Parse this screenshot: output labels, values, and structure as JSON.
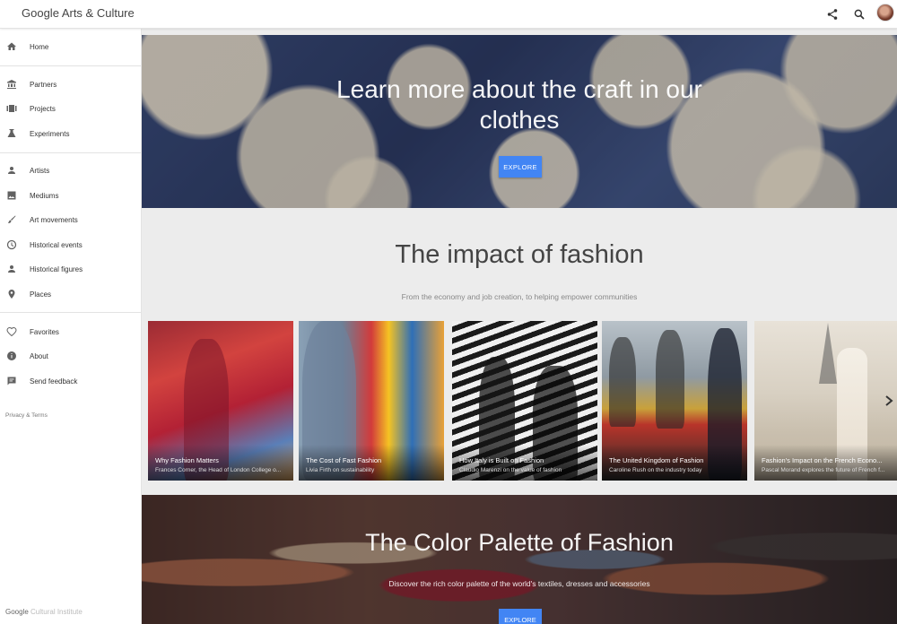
{
  "header": {
    "brand": "Google Arts & Culture",
    "icons": [
      "share-icon",
      "search-icon",
      "avatar"
    ]
  },
  "sidebar": {
    "groups": [
      [
        {
          "label": "Home",
          "icon": "home-icon"
        }
      ],
      [
        {
          "label": "Partners",
          "icon": "museum-icon"
        },
        {
          "label": "Projects",
          "icon": "projects-icon"
        },
        {
          "label": "Experiments",
          "icon": "flask-icon"
        }
      ],
      [
        {
          "label": "Artists",
          "icon": "person-icon"
        },
        {
          "label": "Mediums",
          "icon": "image-icon"
        },
        {
          "label": "Art movements",
          "icon": "brush-icon"
        },
        {
          "label": "Historical events",
          "icon": "clock-icon"
        },
        {
          "label": "Historical figures",
          "icon": "person-icon"
        },
        {
          "label": "Places",
          "icon": "pin-icon"
        }
      ],
      [
        {
          "label": "Favorites",
          "icon": "heart-icon"
        },
        {
          "label": "About",
          "icon": "info-icon"
        },
        {
          "label": "Send feedback",
          "icon": "feedback-icon"
        }
      ]
    ],
    "privacy": "Privacy & Terms",
    "footer_google": "Google",
    "footer_ci": "Cultural Institute"
  },
  "hero": {
    "title": "Learn more about the craft in our clothes",
    "button": "EXPLORE"
  },
  "section": {
    "title": "The impact of fashion",
    "subtitle": "From the economy and job creation, to helping empower communities"
  },
  "cards": [
    {
      "title": "Why Fashion Matters",
      "subtitle": "Frances Corner, the Head of London College o..."
    },
    {
      "title": "The Cost of Fast Fashion",
      "subtitle": "Livia Firth on sustainability"
    },
    {
      "title": "How Italy is Built on Fashion",
      "subtitle": "Claudio Marenzi on the value of fashion"
    },
    {
      "title": "The United Kingdom of Fashion",
      "subtitle": "Caroline Rush on the industry today"
    },
    {
      "title": "Fashion's Impact on the French Econo...",
      "subtitle": "Pascal Morand explores the future of French f..."
    }
  ],
  "runway": {
    "title": "The Color Palette of Fashion",
    "subtitle": "Discover the rich color palette of the world's textiles, dresses and accessories",
    "button": "EXPLORE"
  },
  "colors": {
    "accent": "#4285f4",
    "sidebar_icon": "#616161"
  }
}
